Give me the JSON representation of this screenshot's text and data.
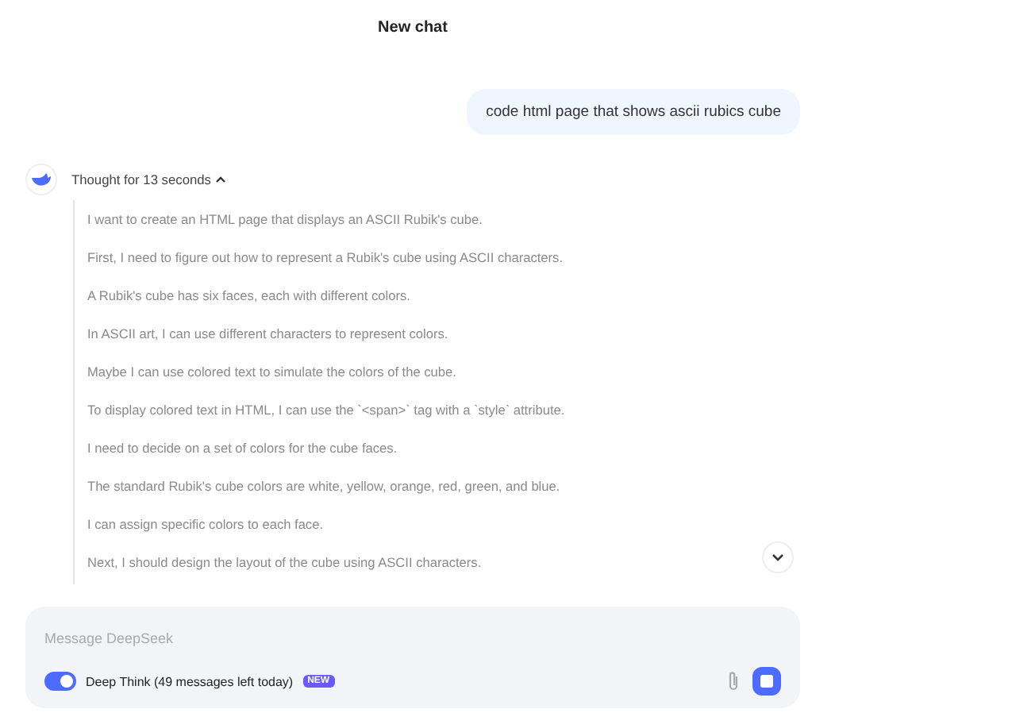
{
  "header": {
    "title": "New chat"
  },
  "user_message": "code html page that shows ascii rubics cube",
  "thought": {
    "label": "Thought for 13 seconds",
    "expanded": true,
    "paragraphs": [
      "I want to create an HTML page that displays an ASCII Rubik's cube.",
      "First, I need to figure out how to represent a Rubik's cube using ASCII characters.",
      "A Rubik's cube has six faces, each with different colors.",
      "In ASCII art, I can use different characters to represent colors.",
      "Maybe I can use colored text to simulate the colors of the cube.",
      "To display colored text in HTML, I can use the `<span>` tag with a `style` attribute.",
      "I need to decide on a set of colors for the cube faces.",
      "The standard Rubik's cube colors are white, yellow, orange, red, green, and blue.",
      "I can assign specific colors to each face.",
      "Next, I should design the layout of the cube using ASCII characters."
    ]
  },
  "composer": {
    "placeholder": "Message DeepSeek",
    "deep_think": {
      "label": "Deep Think (49 messages left today)",
      "on": true,
      "badge": "NEW"
    }
  }
}
